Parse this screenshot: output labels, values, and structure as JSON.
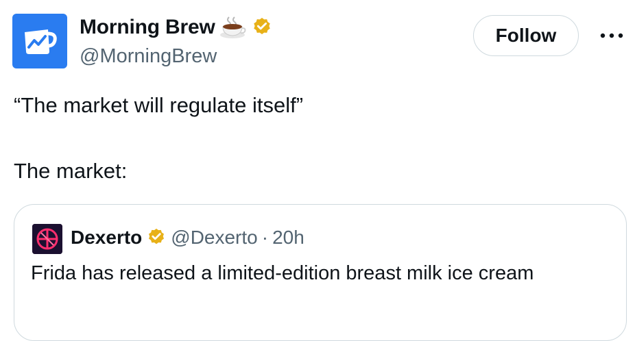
{
  "author": {
    "display_name": "Morning Brew",
    "handle": "@MorningBrew",
    "emoji": "coffee-cup-icon",
    "verified": true,
    "avatar_color": "#2a7cf0"
  },
  "actions": {
    "follow_label": "Follow",
    "more_icon": "more-icon"
  },
  "tweet": {
    "line1": "“The market will regulate itself”",
    "line2": "The market:"
  },
  "quote": {
    "display_name": "Dexerto",
    "handle": "@Dexerto",
    "separator": "·",
    "time": "20h",
    "verified": true,
    "text": "Frida has released a limited-edition breast milk ice cream"
  },
  "colors": {
    "verified_badge": "#e8b118",
    "secondary_text": "#536471",
    "border": "#cfd9de"
  }
}
